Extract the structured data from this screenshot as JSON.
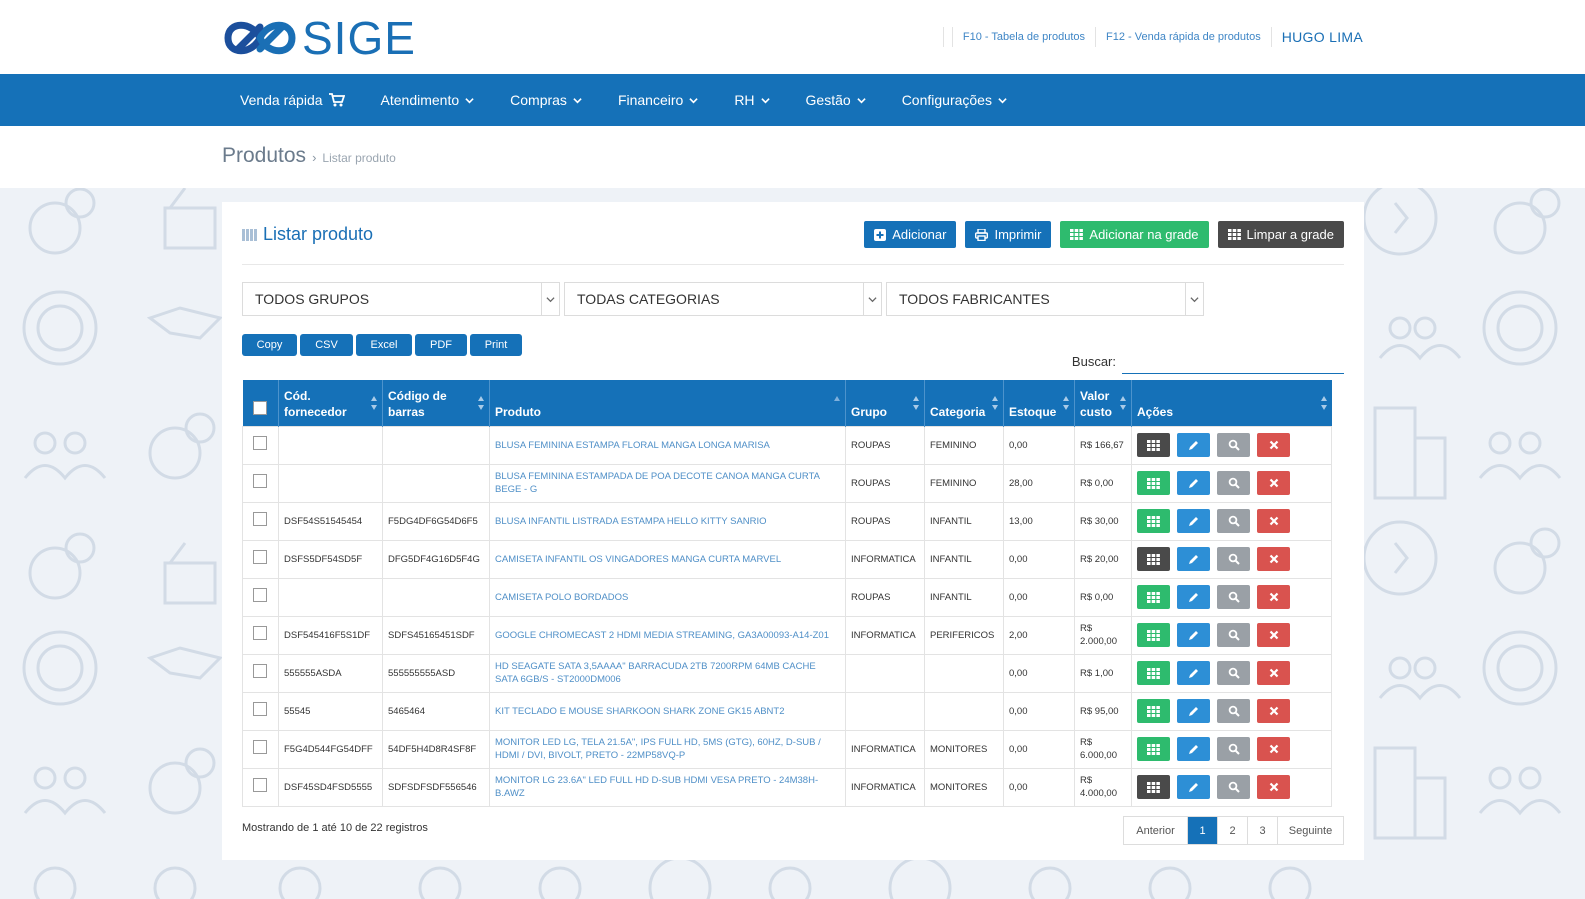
{
  "brand": {
    "name": "SIGE",
    "logo_icon": "sige-infinity-logo"
  },
  "top_links": {
    "f10": "F10 - Tabela de produtos",
    "f12": "F12 - Venda rápida de produtos",
    "user": "HUGO LIMA"
  },
  "nav": {
    "items": [
      {
        "label": "Venda rápida",
        "icon": "cart-icon"
      },
      {
        "label": "Atendimento"
      },
      {
        "label": "Compras"
      },
      {
        "label": "Financeiro"
      },
      {
        "label": "RH"
      },
      {
        "label": "Gestão"
      },
      {
        "label": "Configurações"
      }
    ]
  },
  "breadcrumb": {
    "title": "Produtos",
    "separator": "›",
    "current": "Listar produto"
  },
  "panel": {
    "title": "Listar produto",
    "actions": {
      "add": "Adicionar",
      "print": "Imprimir",
      "add_grid": "Adicionar na grade",
      "clear_grid": "Limpar a grade"
    }
  },
  "filters": {
    "groups": "TODOS GRUPOS",
    "categories": "TODAS CATEGORIAS",
    "manufacturers": "TODOS FABRICANTES"
  },
  "exports": [
    "Copy",
    "CSV",
    "Excel",
    "PDF",
    "Print"
  ],
  "search": {
    "label": "Buscar:",
    "value": ""
  },
  "table": {
    "headers": {
      "supplier_code_1": "Cód.",
      "supplier_code_2": "fornecedor",
      "barcode_1": "Código de",
      "barcode_2": "barras",
      "product": "Produto",
      "group": "Grupo",
      "category": "Categoria",
      "stock": "Estoque",
      "cost_1": "Valor",
      "cost_2": "custo",
      "actions": "Ações"
    },
    "rows": [
      {
        "sup": "",
        "bar": "",
        "prod": "BLUSA FEMININA ESTAMPA FLORAL MANGA LONGA MARISA",
        "grp": "ROUPAS",
        "cat": "FEMININO",
        "stk": "0,00",
        "cost": "R$ 166,67",
        "grid_active": true
      },
      {
        "sup": "",
        "bar": "",
        "prod": "BLUSA FEMININA ESTAMPADA DE POA DECOTE CANOA MANGA CURTA BEGE - G",
        "grp": "ROUPAS",
        "cat": "FEMININO",
        "stk": "28,00",
        "cost": "R$ 0,00",
        "grid_active": false
      },
      {
        "sup": "DSF54S51545454",
        "bar": "F5DG4DF6G54D6F5",
        "prod": "BLUSA INFANTIL LISTRADA ESTAMPA HELLO KITTY SANRIO",
        "grp": "ROUPAS",
        "cat": "INFANTIL",
        "stk": "13,00",
        "cost": "R$ 30,00",
        "grid_active": false
      },
      {
        "sup": "DSFS5DF54SD5F",
        "bar": "DFG5DF4G16D5F4G",
        "prod": "CAMISETA INFANTIL OS VINGADORES MANGA CURTA MARVEL",
        "grp": "INFORMATICA",
        "cat": "INFANTIL",
        "stk": "0,00",
        "cost": "R$ 20,00",
        "grid_active": true
      },
      {
        "sup": "",
        "bar": "",
        "prod": "CAMISETA POLO BORDADOS",
        "grp": "ROUPAS",
        "cat": "INFANTIL",
        "stk": "0,00",
        "cost": "R$ 0,00",
        "grid_active": false
      },
      {
        "sup": "DSF545416F5S1DF",
        "bar": "SDFS45165451SDF",
        "prod": "GOOGLE CHROMECAST 2 HDMI MEDIA STREAMING, GA3A00093-A14-Z01",
        "grp": "INFORMATICA",
        "cat": "PERIFERICOS",
        "stk": "2,00",
        "cost": "R$ 2.000,00",
        "grid_active": false
      },
      {
        "sup": "555555ASDA",
        "bar": "555555555ASD",
        "prod": "HD SEAGATE SATA 3,5AAAA\" BARRACUDA 2TB 7200RPM 64MB CACHE SATA 6GB/S - ST2000DM006",
        "grp": "",
        "cat": "",
        "stk": "0,00",
        "cost": "R$ 1,00",
        "grid_active": false
      },
      {
        "sup": "55545",
        "bar": "5465464",
        "prod": "KIT TECLADO E MOUSE SHARKOON SHARK ZONE GK15 ABNT2",
        "grp": "",
        "cat": "",
        "stk": "0,00",
        "cost": "R$ 95,00",
        "grid_active": false
      },
      {
        "sup": "F5G4D544FG54DFF",
        "bar": "54DF5H4D8R4SF8F",
        "prod": "MONITOR LED LG, TELA 21.5A\", IPS FULL HD, 5MS (GTG), 60HZ, D-SUB / HDMI / DVI, BIVOLT, PRETO - 22MP58VQ-P",
        "grp": "INFORMATICA",
        "cat": "MONITORES",
        "stk": "0,00",
        "cost": "R$ 6.000,00",
        "grid_active": false
      },
      {
        "sup": "DSF45SD4FSD5555",
        "bar": "SDFSDFSDF556546",
        "prod": "MONITOR LG 23.6A\" LED FULL HD D-SUB HDMI VESA PRETO - 24M38H-B.AWZ",
        "grp": "INFORMATICA",
        "cat": "MONITORES",
        "stk": "0,00",
        "cost": "R$ 4.000,00",
        "grid_active": true
      }
    ]
  },
  "footer": {
    "info": "Mostrando de 1 até 10 de 22 registros",
    "pager": {
      "prev": "Anterior",
      "pages": [
        "1",
        "2",
        "3"
      ],
      "active": "1",
      "next": "Seguinte"
    }
  },
  "colors": {
    "primary": "#1571b8",
    "success": "#2ebb6e",
    "dark": "#4a4a4a",
    "danger": "#d9534f",
    "muted": "#9aa0a6",
    "edit": "#2d8fd6"
  }
}
